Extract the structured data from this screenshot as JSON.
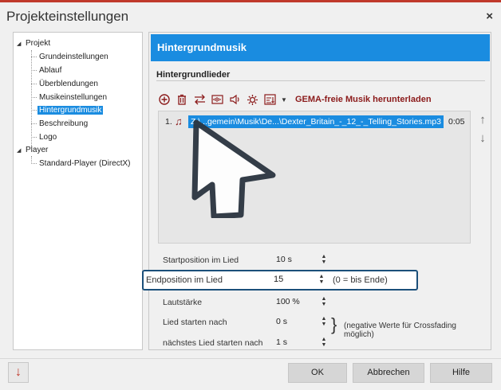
{
  "window": {
    "title": "Projekteinstellungen",
    "close_glyph": "×"
  },
  "tree": {
    "project": "Projekt",
    "project_items": [
      "Grundeinstellungen",
      "Ablauf",
      "Überblendungen",
      "Musikeinstellungen",
      "Hintergrundmusik",
      "Beschreibung",
      "Logo"
    ],
    "selected": "Hintergrundmusik",
    "player": "Player",
    "player_items": [
      "Standard-Player (DirectX)"
    ]
  },
  "panel": {
    "header": "Hintergrundmusik",
    "section": "Hintergrundlieder",
    "toolbar": {
      "icons": [
        "add-icon",
        "delete-icon",
        "swap-icon",
        "waveform-icon",
        "volume-icon",
        "settings-icon",
        "sort-icon",
        "dropdown-icon"
      ],
      "gema_link": "GEMA-freie Musik herunterladen"
    },
    "tracks": [
      {
        "num": "1.",
        "name": "Z:\\...gemein\\Musik\\De...\\Dexter_Britain_-_12_-_Telling_Stories.mp3",
        "duration": "0:05"
      }
    ],
    "up_glyph": "↑",
    "down_glyph": "↓"
  },
  "settings": {
    "start_label": "Startposition im Lied",
    "start_value": "10 s",
    "end_label": "Endposition im Lied",
    "end_value": "15",
    "end_hint": "(0 = bis Ende)",
    "volume_label": "Lautstärke",
    "volume_value": "100 %",
    "song_start_label": "Lied starten nach",
    "song_start_value": "0 s",
    "next_start_label": "nächstes Lied starten nach",
    "next_start_value": "1 s",
    "crossfade_note": "(negative Werte für Crossfading möglich)"
  },
  "footer": {
    "ok_label": "OK",
    "cancel_label": "Abbrechen",
    "help_label": "Hilfe",
    "bottom_arrow_glyph": "↓"
  },
  "colors": {
    "accent": "#1a8ce0",
    "brand_red": "#8b1a1a",
    "highlight_border": "#1b4f7a"
  }
}
